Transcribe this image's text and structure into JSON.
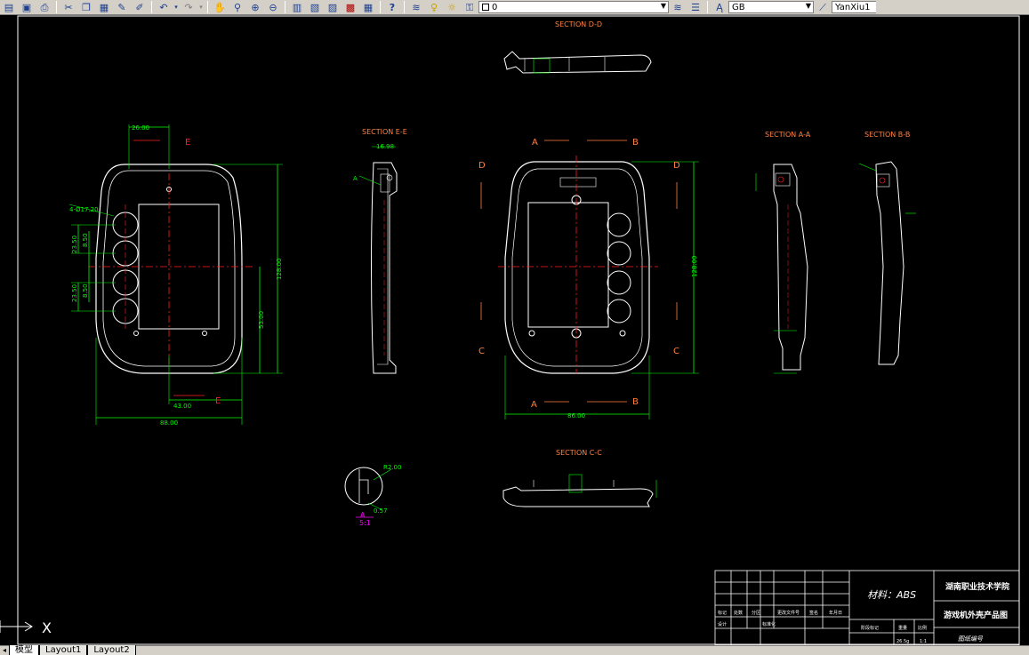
{
  "toolbar": {
    "layer_name": "0",
    "text_style": "GB",
    "dim_style": "YanXiu1",
    "icons": [
      "open-icon",
      "save-icon",
      "print-icon",
      "cut-icon",
      "copy-icon",
      "paste-icon",
      "matchprop-icon",
      "undo-icon",
      "redo-icon",
      "pan-icon",
      "zoom-realtime-icon",
      "zoom-window-icon",
      "zoom-previous-icon",
      "properties-icon",
      "designcenter-icon",
      "toolpalettes-icon",
      "markup-icon",
      "calculator-icon",
      "help-icon",
      "layers-icon"
    ]
  },
  "drawing": {
    "sections": {
      "dd": "SECTION D-D",
      "ee": "SECTION E-E",
      "aa": "SECTION A-A",
      "bb": "SECTION B-B",
      "cc": "SECTION C-C"
    },
    "labels": {
      "E_top": "E",
      "E_bottom": "E",
      "A_top": "A",
      "B_top": "B",
      "A_bottom": "A",
      "B_bottom": "B",
      "D_left": "D",
      "D_right": "D",
      "C_left": "C",
      "C_right": "C",
      "A_detail": "A",
      "A_ee": "A",
      "detail_scale": "5:1"
    },
    "dims": {
      "d_2600": "26.00",
      "d_phi": "4-Ø17.20",
      "d_2350a": "23.50",
      "d_850a": "8.50",
      "d_2350b": "23.50",
      "d_850b": "8.50",
      "d_12800": "128.00",
      "d_5300": "53.00",
      "d_4300": "43.00",
      "d_8800": "88.00",
      "d_1698": "16.98",
      "d_12800b": "128.00",
      "d_8600": "86.00",
      "d_r2": "R2.00",
      "d_057": "0.57"
    }
  },
  "title_block": {
    "material": "材料：ABS",
    "school": "湖南职业技术学院",
    "title": "游戏机外壳产品图",
    "drawing_no": "图纸编号",
    "scale": "1:1",
    "headers": [
      "标记",
      "处数",
      "分区",
      "更改文件号",
      "签名",
      "年月日"
    ],
    "row2": [
      "设计",
      "标准化"
    ],
    "stage": "阶段标记",
    "weight": "重量",
    "ratio": "比例",
    "value_weight": "26.5g"
  },
  "ucs": {
    "x_label": "X"
  },
  "tabs": [
    "模型",
    "Layout1",
    "Layout2"
  ]
}
